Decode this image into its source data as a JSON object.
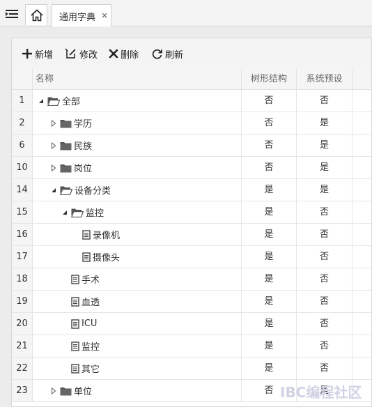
{
  "tabs": {
    "menu_icon": "menu-icon",
    "home_icon": "home-icon",
    "active_tab_label": "通用字典",
    "close_label": "×"
  },
  "toolbar": {
    "add_label": "新增",
    "edit_label": "修改",
    "delete_label": "删除",
    "refresh_label": "刷新"
  },
  "columns": {
    "name": "名称",
    "tree": "树形结构",
    "system": "系统预设"
  },
  "rows": [
    {
      "num": "1",
      "name": "全部",
      "tree": "否",
      "system": "否",
      "level": 0,
      "expander": "expanded",
      "icon": "folder-open"
    },
    {
      "num": "2",
      "name": "学历",
      "tree": "否",
      "system": "是",
      "level": 1,
      "expander": "collapsed",
      "icon": "folder"
    },
    {
      "num": "6",
      "name": "民族",
      "tree": "否",
      "system": "是",
      "level": 1,
      "expander": "collapsed",
      "icon": "folder"
    },
    {
      "num": "10",
      "name": "岗位",
      "tree": "否",
      "system": "是",
      "level": 1,
      "expander": "collapsed",
      "icon": "folder"
    },
    {
      "num": "14",
      "name": "设备分类",
      "tree": "是",
      "system": "是",
      "level": 1,
      "expander": "expanded",
      "icon": "folder-open"
    },
    {
      "num": "15",
      "name": "监控",
      "tree": "是",
      "system": "否",
      "level": 2,
      "expander": "expanded",
      "icon": "folder-open"
    },
    {
      "num": "16",
      "name": "录像机",
      "tree": "是",
      "system": "否",
      "level": 3,
      "expander": "none",
      "icon": "file"
    },
    {
      "num": "17",
      "name": "摄像头",
      "tree": "是",
      "system": "否",
      "level": 3,
      "expander": "none",
      "icon": "file"
    },
    {
      "num": "18",
      "name": "手术",
      "tree": "是",
      "system": "否",
      "level": 2,
      "expander": "none",
      "icon": "file"
    },
    {
      "num": "19",
      "name": "血透",
      "tree": "是",
      "system": "否",
      "level": 2,
      "expander": "none",
      "icon": "file"
    },
    {
      "num": "20",
      "name": "ICU",
      "tree": "是",
      "system": "否",
      "level": 2,
      "expander": "none",
      "icon": "file"
    },
    {
      "num": "21",
      "name": "监控",
      "tree": "是",
      "system": "否",
      "level": 2,
      "expander": "none",
      "icon": "file"
    },
    {
      "num": "22",
      "name": "其它",
      "tree": "是",
      "system": "否",
      "level": 2,
      "expander": "none",
      "icon": "file"
    },
    {
      "num": "23",
      "name": "单位",
      "tree": "否",
      "system": "是",
      "level": 1,
      "expander": "collapsed",
      "icon": "folder"
    }
  ],
  "watermark": "IBC编程社区"
}
